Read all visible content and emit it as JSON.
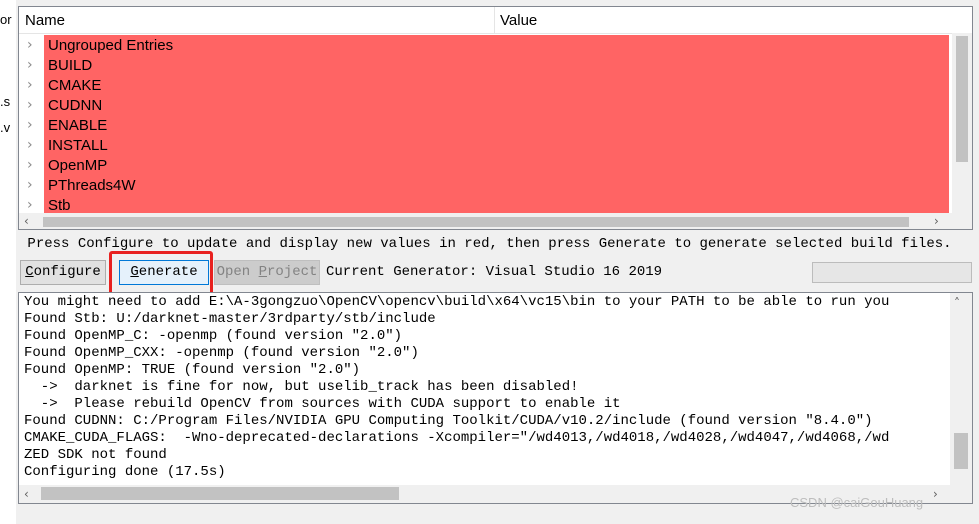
{
  "left_clip": [
    "or",
    ".s",
    ".v"
  ],
  "tree": {
    "columns": {
      "name": "Name",
      "value": "Value"
    },
    "entries": [
      "Ungrouped Entries",
      "BUILD",
      "CMAKE",
      "CUDNN",
      "ENABLE",
      "INSTALL",
      "OpenMP",
      "PThreads4W",
      "Stb"
    ],
    "highlight_color": "#ff6464"
  },
  "hint": "Press Configure to update and display new values in red, then press Generate to generate selected build files.",
  "buttons": {
    "configure": {
      "label_u": "C",
      "label_rest": "onfigure"
    },
    "generate": {
      "label_u": "G",
      "label_rest": "enerate"
    },
    "open_project": {
      "label_pre": "Open ",
      "label_u": "P",
      "label_rest": "roject"
    }
  },
  "generator": "Current Generator: Visual Studio 16 2019",
  "log": [
    "You might need to add E:\\A-3gongzuo\\OpenCV\\opencv\\build\\x64\\vc15\\bin to your PATH to be able to run you",
    "Found Stb: U:/darknet-master/3rdparty/stb/include",
    "Found OpenMP_C: -openmp (found version \"2.0\")",
    "Found OpenMP_CXX: -openmp (found version \"2.0\")",
    "Found OpenMP: TRUE (found version \"2.0\")",
    "  ->  darknet is fine for now, but uselib_track has been disabled!",
    "  ->  Please rebuild OpenCV from sources with CUDA support to enable it",
    "Found CUDNN: C:/Program Files/NVIDIA GPU Computing Toolkit/CUDA/v10.2/include (found version \"8.4.0\")",
    "CMAKE_CUDA_FLAGS:  -Wno-deprecated-declarations -Xcompiler=\"/wd4013,/wd4018,/wd4028,/wd4047,/wd4068,/wd",
    "ZED SDK not found",
    "Configuring done (17.5s)"
  ],
  "watermark": "CSDN @caiGouHuang",
  "icons": {
    "chevron": "chevron-right-icon",
    "arrow_up": "arrow-up-icon",
    "arrow_down": "arrow-down-icon",
    "arrow_left": "arrow-left-icon",
    "arrow_right": "arrow-right-icon"
  }
}
